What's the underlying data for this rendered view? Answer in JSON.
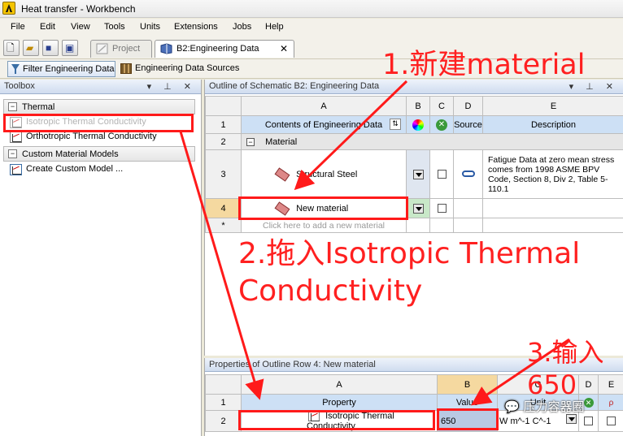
{
  "window": {
    "title": "Heat transfer - Workbench"
  },
  "menu": [
    "File",
    "Edit",
    "View",
    "Tools",
    "Units",
    "Extensions",
    "Jobs",
    "Help"
  ],
  "tabs": {
    "project": "Project",
    "engineering_data": "B2:Engineering Data",
    "close": "✕"
  },
  "toolbar2": {
    "filter": "Filter Engineering Data",
    "sources": "Engineering Data Sources"
  },
  "toolbox": {
    "title": "Toolbox",
    "controls": "▾ ⊥ ✕",
    "groups": [
      {
        "label": "Thermal",
        "items": [
          "Isotropic Thermal Conductivity",
          "Orthotropic Thermal Conductivity"
        ]
      },
      {
        "label": "Custom Material Models",
        "items": [
          "Create Custom Model ..."
        ]
      }
    ]
  },
  "outline": {
    "title": "Outline of Schematic B2: Engineering Data",
    "columns": [
      "A",
      "B",
      "C",
      "D",
      "E"
    ],
    "row_numbers": [
      "1",
      "2",
      "3",
      "4",
      "*"
    ],
    "header_row": {
      "a": "Contents of Engineering Data",
      "d": "Source",
      "e": "Description"
    },
    "section": "Material",
    "materials": [
      {
        "name": "Structural Steel",
        "description": "Fatigue Data at zero mean stress comes from 1998 ASME BPV Code, Section 8, Div 2, Table 5-110.1"
      },
      {
        "name": "New material",
        "description": ""
      }
    ],
    "add_placeholder": "Click here to add a new material"
  },
  "properties": {
    "title": "Properties of Outline Row 4: New material",
    "columns": [
      "A",
      "B",
      "C",
      "D",
      "E"
    ],
    "row_numbers": [
      "1",
      "2"
    ],
    "header": {
      "property": "Property",
      "value": "Value",
      "unit": "Unit"
    },
    "rows": [
      {
        "property": "Isotropic Thermal Conductivity",
        "value": "650",
        "unit": "W m^-1 C^-1"
      }
    ]
  },
  "annotations": {
    "step1": "1.新建material",
    "step2_line1": "2.拖入Isotropic Thermal",
    "step2_line2": "Conductivity",
    "step3_line1": "3.输入",
    "step3_line2": "650",
    "color": "#ff1a1a"
  },
  "watermark": "压力容器圈"
}
